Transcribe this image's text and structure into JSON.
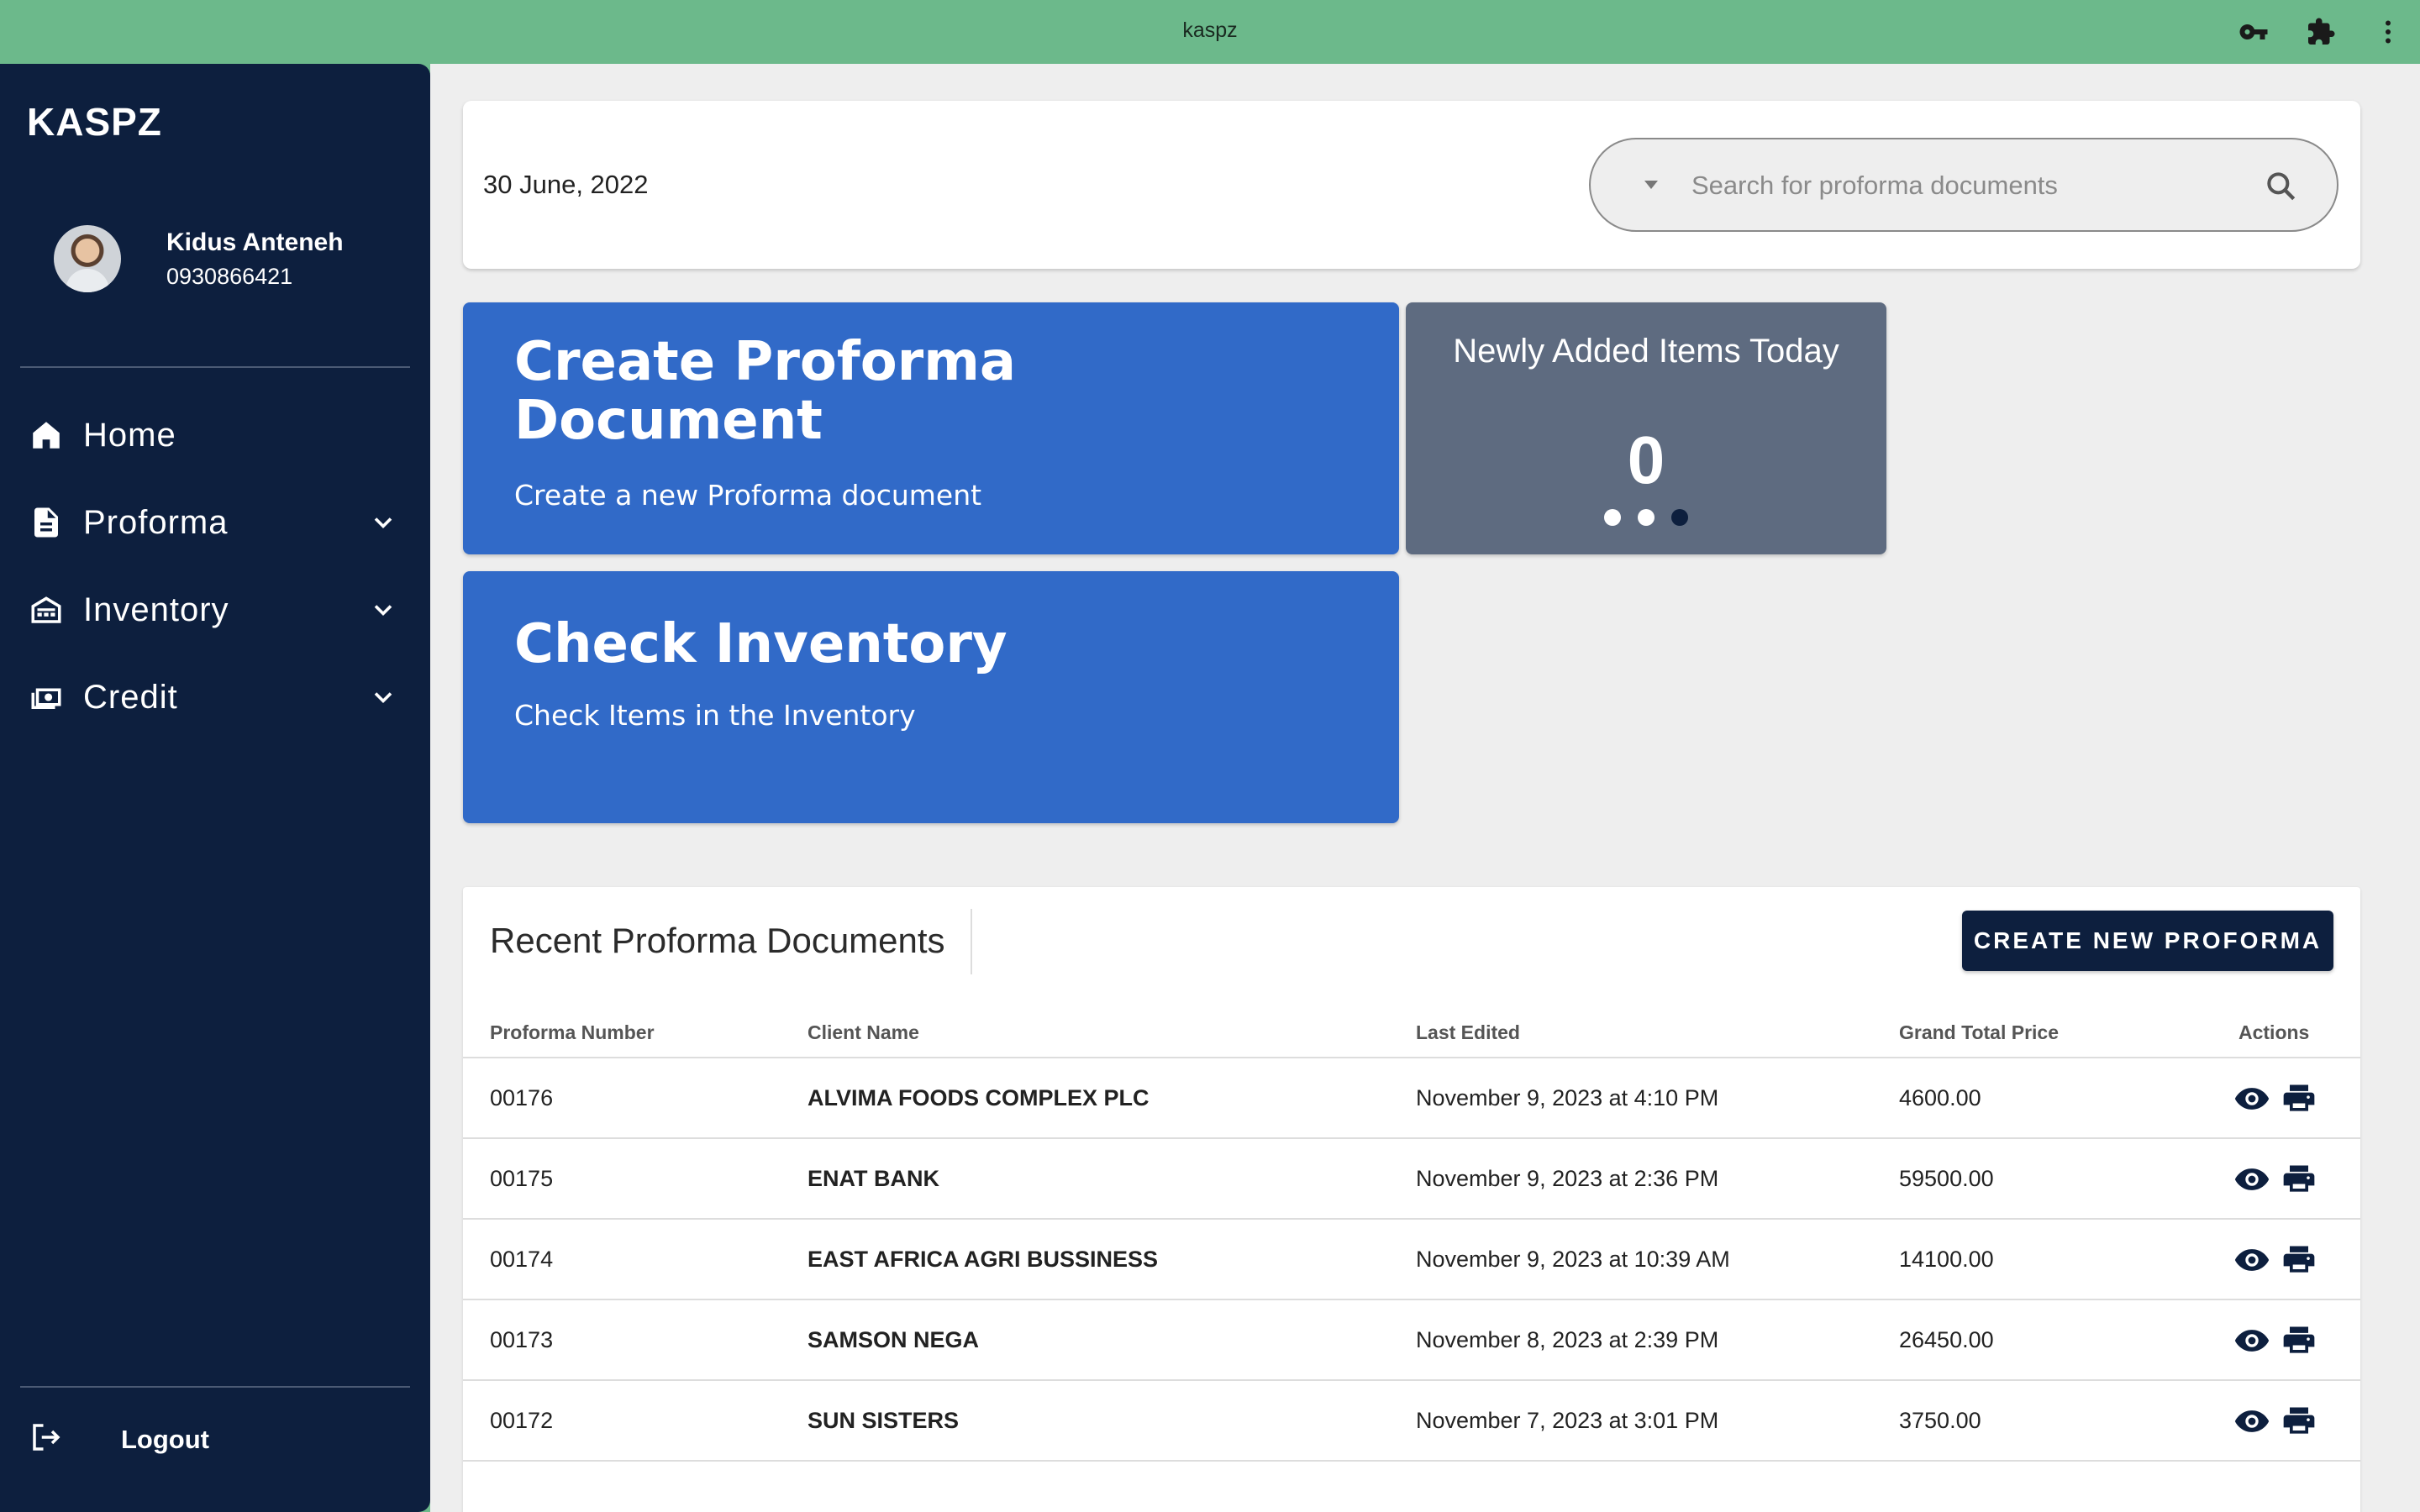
{
  "window": {
    "title": "kaspz",
    "icons": [
      "key-icon",
      "puzzle-icon",
      "more-vert-icon"
    ]
  },
  "sidebar": {
    "brand": "KASPZ",
    "user": {
      "name": "Kidus Anteneh",
      "phone": "0930866421"
    },
    "items": [
      {
        "label": "Home",
        "icon": "home-icon",
        "expandable": false
      },
      {
        "label": "Proforma",
        "icon": "document-icon",
        "expandable": true
      },
      {
        "label": "Inventory",
        "icon": "warehouse-icon",
        "expandable": true
      },
      {
        "label": "Credit",
        "icon": "money-icon",
        "expandable": true
      }
    ],
    "logout_label": "Logout"
  },
  "header": {
    "date": "30 June, 2022",
    "search_placeholder": "Search for proforma documents"
  },
  "tiles": {
    "create": {
      "title": "Create Proforma Document",
      "subtitle": "Create a new Proforma document"
    },
    "inventory": {
      "title": "Check Inventory",
      "subtitle": "Check Items in the Inventory"
    },
    "newly_added": {
      "title": "Newly Added Items Today",
      "count": "0",
      "carousel_pages": 3,
      "active_page": 3
    }
  },
  "recent": {
    "title": "Recent Proforma Documents",
    "create_button": "CREATE NEW PROFORMA",
    "columns": [
      "Proforma Number",
      "Client Name",
      "Last Edited",
      "Grand Total Price",
      "Actions"
    ],
    "rows": [
      {
        "number": "00176",
        "client": "ALVIMA FOODS COMPLEX PLC",
        "edited": "November 9, 2023 at 4:10 PM",
        "total": "4600.00"
      },
      {
        "number": "00175",
        "client": "ENAT BANK",
        "edited": "November 9, 2023 at 2:36 PM",
        "total": "59500.00"
      },
      {
        "number": "00174",
        "client": "EAST AFRICA AGRI BUSSINESS",
        "edited": "November 9, 2023 at 10:39 AM",
        "total": "14100.00"
      },
      {
        "number": "00173",
        "client": "SAMSON NEGA",
        "edited": "November 8, 2023 at 2:39 PM",
        "total": "26450.00"
      },
      {
        "number": "00172",
        "client": "SUN SISTERS",
        "edited": "November 7, 2023 at 3:01 PM",
        "total": "3750.00"
      }
    ]
  },
  "colors": {
    "titlebar": "#6cb98b",
    "sidebar": "#0d1f3e",
    "tile_blue": "#316ac8",
    "tile_gray": "#5e6b80",
    "main_bg": "#eeeeee"
  }
}
